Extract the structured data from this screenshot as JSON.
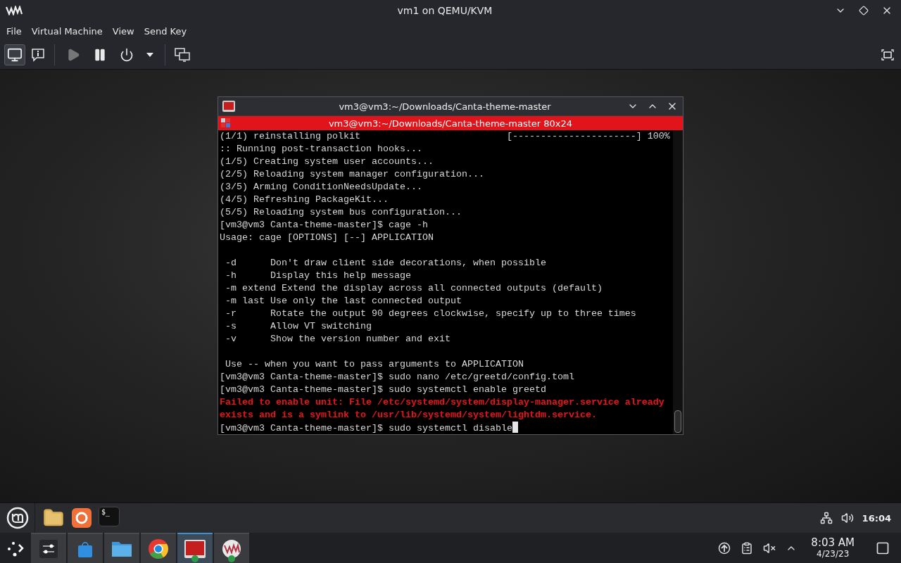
{
  "window": {
    "title": "vm1 on QEMU/KVM"
  },
  "menu": [
    "File",
    "Virtual Machine",
    "View",
    "Send Key"
  ],
  "toolbar": {
    "views": [
      {
        "kind": "console",
        "selected": true
      },
      {
        "kind": "details",
        "selected": false
      }
    ],
    "actions": [
      {
        "kind": "run",
        "disabled": true
      },
      {
        "kind": "pause",
        "disabled": false
      },
      {
        "kind": "shutdown",
        "disabled": false
      },
      {
        "kind": "shutdown-menu",
        "disabled": false
      }
    ]
  },
  "terminal": {
    "title": "vm3@vm3:~/Downloads/Canta-theme-master",
    "tab_title": "vm3@vm3:~/Downloads/Canta-theme-master 80x24",
    "lines": [
      {
        "kind": "output",
        "text": "(1/1) reinstalling polkit                          [----------------------] 100%"
      },
      {
        "kind": "output",
        "text": ":: Running post-transaction hooks..."
      },
      {
        "kind": "output",
        "text": "(1/5) Creating system user accounts..."
      },
      {
        "kind": "output",
        "text": "(2/5) Reloading system manager configuration..."
      },
      {
        "kind": "output",
        "text": "(3/5) Arming ConditionNeedsUpdate..."
      },
      {
        "kind": "output",
        "text": "(4/5) Refreshing PackageKit..."
      },
      {
        "kind": "output",
        "text": "(5/5) Reloading system bus configuration..."
      },
      {
        "kind": "output",
        "text": "[vm3@vm3 Canta-theme-master]$ cage -h"
      },
      {
        "kind": "output",
        "text": "Usage: cage [OPTIONS] [--] APPLICATION"
      },
      {
        "kind": "blank"
      },
      {
        "kind": "output",
        "text": " -d      Don't draw client side decorations, when possible"
      },
      {
        "kind": "output",
        "text": " -h      Display this help message"
      },
      {
        "kind": "output",
        "text": " -m extend Extend the display across all connected outputs (default)"
      },
      {
        "kind": "output",
        "text": " -m last Use only the last connected output"
      },
      {
        "kind": "output",
        "text": " -r      Rotate the output 90 degrees clockwise, specify up to three times"
      },
      {
        "kind": "output",
        "text": " -s      Allow VT switching"
      },
      {
        "kind": "output",
        "text": " -v      Show the version number and exit"
      },
      {
        "kind": "blank"
      },
      {
        "kind": "output",
        "text": " Use -- when you want to pass arguments to APPLICATION"
      },
      {
        "kind": "output",
        "text": "[vm3@vm3 Canta-theme-master]$ sudo nano /etc/greetd/config.toml"
      },
      {
        "kind": "output",
        "text": "[vm3@vm3 Canta-theme-master]$ sudo systemctl enable greetd"
      },
      {
        "kind": "error",
        "text": "Failed to enable unit: File /etc/systemd/system/display-manager.service already"
      },
      {
        "kind": "error",
        "text": "exists and is a symlink to /usr/lib/systemd/system/lightdm.service."
      },
      {
        "kind": "input",
        "text": "[vm3@vm3 Canta-theme-master]$ sudo systemctl disable"
      }
    ]
  },
  "guest_panel": {
    "launchers": [
      {
        "kind": "folder"
      },
      {
        "kind": "firefox"
      },
      {
        "kind": "terminal",
        "glyph": "$_"
      }
    ],
    "clock": "16:04"
  },
  "host_taskbar": {
    "tasks": [
      {
        "kind": "settings",
        "selected": false
      },
      {
        "kind": "store",
        "selected": false
      },
      {
        "kind": "files",
        "selected": false
      },
      {
        "kind": "browser",
        "selected": false
      },
      {
        "kind": "terminal",
        "selected": true
      },
      {
        "kind": "vm",
        "selected": false
      }
    ],
    "time": "8:03 AM",
    "date": "4/23/23"
  }
}
